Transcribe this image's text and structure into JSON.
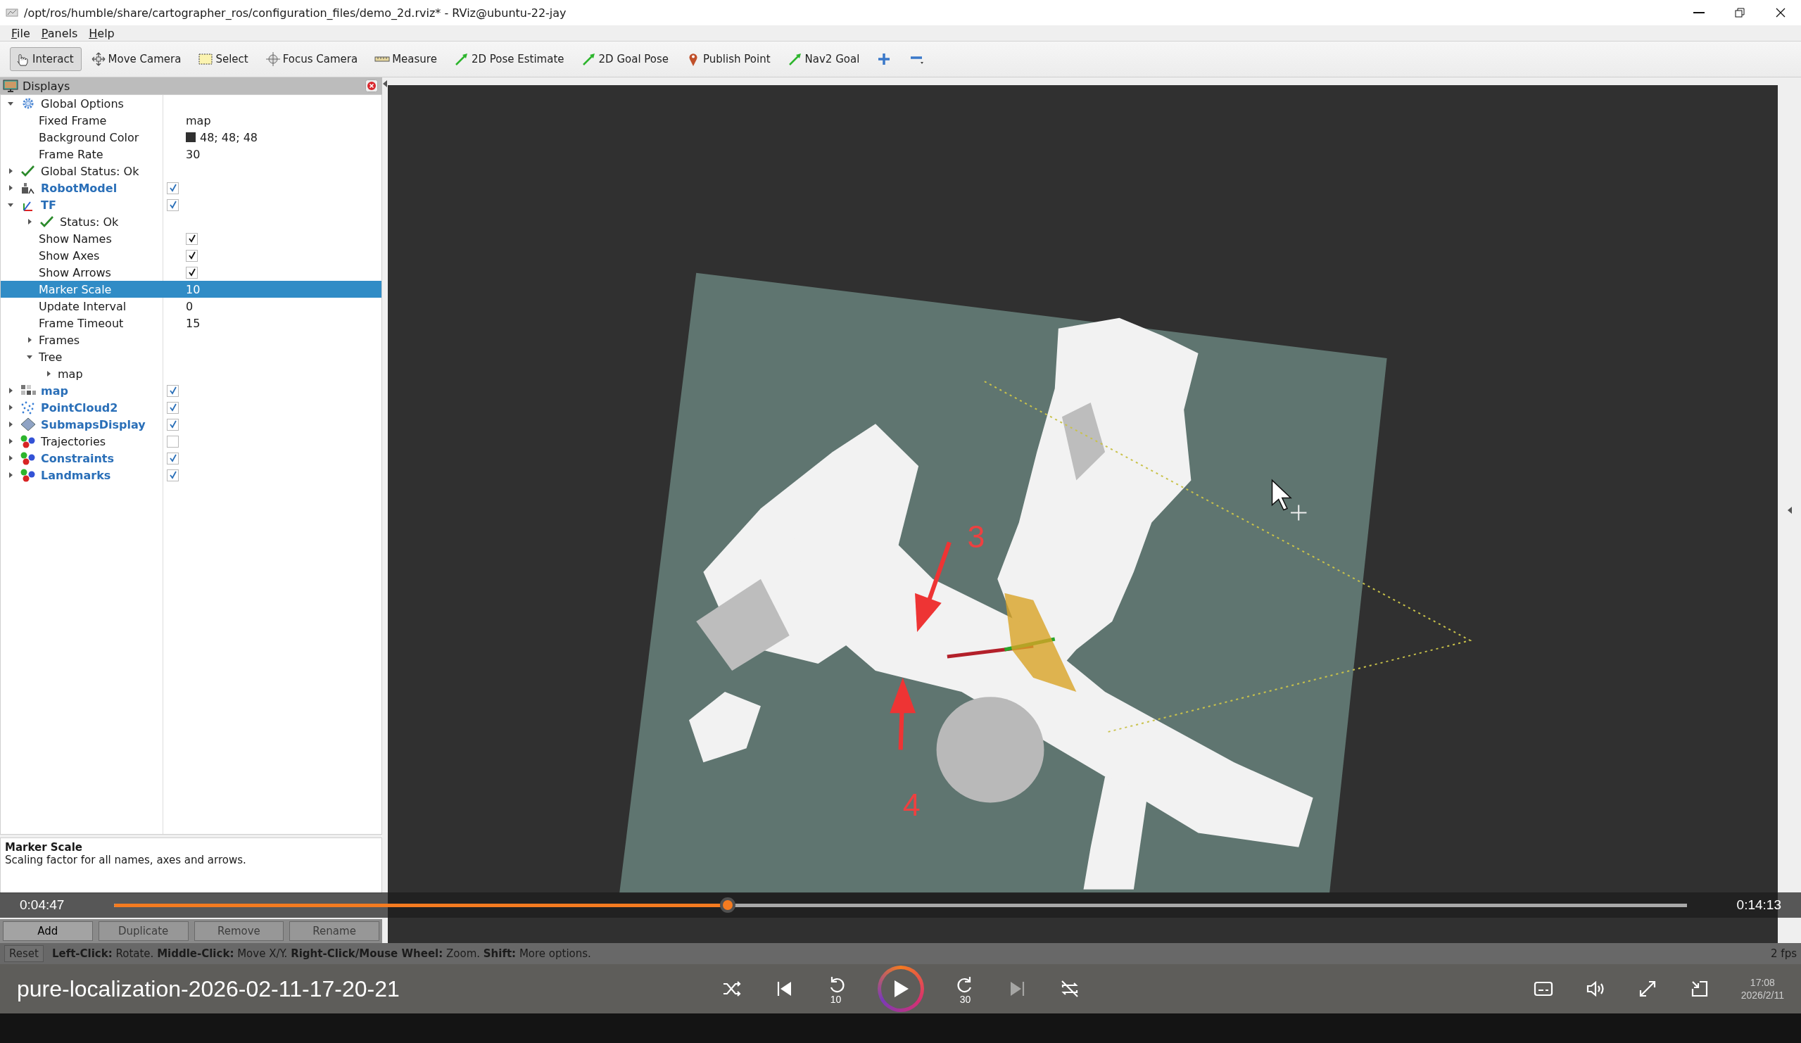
{
  "window": {
    "title": "/opt/ros/humble/share/cartographer_ros/configuration_files/demo_2d.rviz* - RViz@ubuntu-22-jay"
  },
  "menu": [
    "File",
    "Panels",
    "Help"
  ],
  "toolbar": [
    {
      "label": "Interact",
      "kind": "interact",
      "selected": true
    },
    {
      "label": "Move Camera",
      "kind": "move",
      "selected": false
    },
    {
      "label": "Select",
      "kind": "select",
      "selected": false
    },
    {
      "label": "Focus Camera",
      "kind": "focus",
      "selected": false
    },
    {
      "label": "Measure",
      "kind": "measure",
      "selected": false
    },
    {
      "label": "2D Pose Estimate",
      "kind": "pose",
      "selected": false
    },
    {
      "label": "2D Goal Pose",
      "kind": "pose",
      "selected": false
    },
    {
      "label": "Publish Point",
      "kind": "pin",
      "selected": false
    },
    {
      "label": "Nav2 Goal",
      "kind": "pose",
      "selected": false
    },
    {
      "kind": "add",
      "selected": false
    },
    {
      "kind": "remove",
      "selected": false
    }
  ],
  "displays_panel": {
    "title": "Displays",
    "tree": [
      {
        "label": "Global Options",
        "kind": "options",
        "expanded": true,
        "selected": false,
        "children": [
          {
            "label": "Fixed Frame",
            "kind": "property",
            "value": "map",
            "selected": false
          },
          {
            "label": "Background Color",
            "kind": "property",
            "value": "48; 48; 48",
            "color": "#303030",
            "selected": false
          },
          {
            "label": "Frame Rate",
            "kind": "property",
            "value": "30",
            "selected": false
          }
        ]
      },
      {
        "label": "Global Status: Ok",
        "kind": "status",
        "expanded": false,
        "selected": false
      },
      {
        "label": "RobotModel",
        "kind": "robot_model",
        "expanded": false,
        "checked": true,
        "selected": false
      },
      {
        "label": "TF",
        "kind": "tf",
        "expanded": true,
        "checked": true,
        "selected": false,
        "children": [
          {
            "label": "Status: Ok",
            "kind": "status",
            "expanded": false,
            "selected": false
          },
          {
            "label": "Show Names",
            "kind": "property",
            "checked": true,
            "selected": false
          },
          {
            "label": "Show Axes",
            "kind": "property",
            "checked": true,
            "selected": false
          },
          {
            "label": "Show Arrows",
            "kind": "property",
            "checked": true,
            "selected": false
          },
          {
            "label": "Marker Scale",
            "kind": "property",
            "value": "10",
            "selected": true
          },
          {
            "label": "Update Interval",
            "kind": "property",
            "value": "0",
            "selected": false
          },
          {
            "label": "Frame Timeout",
            "kind": "property",
            "value": "15",
            "selected": false
          },
          {
            "label": "Frames",
            "kind": "property",
            "expanded": false,
            "selected": false
          },
          {
            "label": "Tree",
            "kind": "property",
            "expanded": true,
            "selected": false,
            "children": [
              {
                "label": "map",
                "kind": "property",
                "expanded": false,
                "selected": false
              }
            ]
          }
        ]
      },
      {
        "label": "map",
        "kind": "map",
        "expanded": false,
        "checked": true,
        "selected": false
      },
      {
        "label": "PointCloud2",
        "kind": "pointcloud",
        "expanded": false,
        "checked": true,
        "selected": false
      },
      {
        "label": "SubmapsDisplay",
        "kind": "submaps",
        "expanded": false,
        "checked": true,
        "selected": false
      },
      {
        "label": "Trajectories",
        "kind": "markers",
        "expanded": false,
        "checked": false,
        "selected": false
      },
      {
        "label": "Constraints",
        "kind": "markers",
        "expanded": false,
        "checked": true,
        "selected": false
      },
      {
        "label": "Landmarks",
        "kind": "markers",
        "expanded": false,
        "checked": true,
        "selected": false
      }
    ],
    "description": {
      "title": "Marker Scale",
      "text": "Scaling factor for all names, axes and arrows."
    },
    "buttons": [
      {
        "label": "Add",
        "disabled": false
      },
      {
        "label": "Duplicate",
        "disabled": true
      },
      {
        "label": "Remove",
        "disabled": true
      },
      {
        "label": "Rename",
        "disabled": true
      }
    ]
  },
  "viewport": {
    "annotations": [
      {
        "text": "3"
      },
      {
        "text": "4"
      }
    ]
  },
  "status_bar": {
    "reset": "Reset",
    "help": "**Left-Click:** Rotate. **Middle-Click:** Move X/Y. **Right-Click/Mouse Wheel:** Zoom. **Shift:** More options.",
    "fps": "2 fps"
  },
  "player": {
    "elapsed": "0:04:47",
    "duration": "0:14:13",
    "level": 0.39,
    "title": "pure-localization-2026-02-11-17-20-21",
    "controls": [
      {
        "kind": "shuffle",
        "disabled": false
      },
      {
        "kind": "previous",
        "disabled": false
      },
      {
        "kind": "rewind",
        "label": "10",
        "disabled": false
      },
      {
        "kind": "play",
        "disabled": false
      },
      {
        "kind": "forward",
        "label": "30",
        "disabled": false
      },
      {
        "kind": "next",
        "disabled": true
      },
      {
        "kind": "repeat",
        "disabled": false
      }
    ],
    "right_controls": [
      {
        "kind": "subtitles"
      },
      {
        "kind": "volume"
      },
      {
        "kind": "fullscreen"
      },
      {
        "kind": "mini_player"
      }
    ],
    "clock": {
      "time": "17:08",
      "date": "2026/2/11"
    }
  }
}
